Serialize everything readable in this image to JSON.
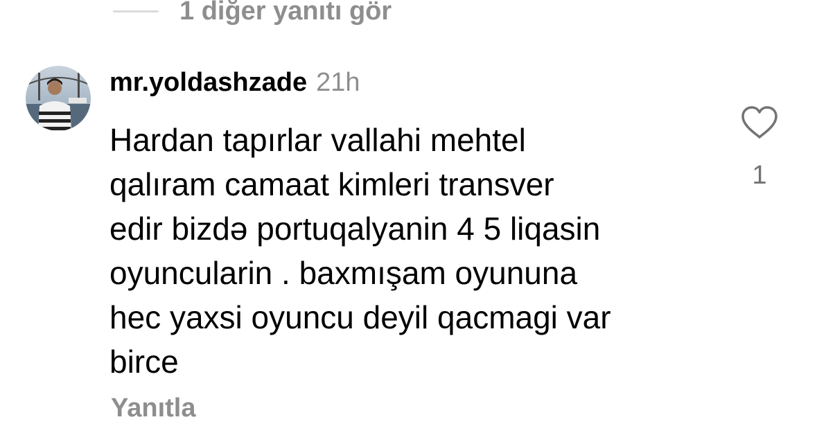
{
  "view_replies": {
    "label": "1 diğer yanıtı gör"
  },
  "comment": {
    "avatar_icon": "user-avatar-photo",
    "username": "mr.yoldashzade",
    "time": "21h",
    "text_lines": [
      "Hardan tapırlar vallahi  mehtel",
      "qalıram camaat kimleri transver",
      "edir bizdə portuqalyanin 4 5 liqasin",
      "oyuncularin . baxmışam oyununa",
      "hec yaxsi oyuncu deyil qacmagi var",
      "birce"
    ],
    "reply_label": "Yanıtla",
    "like_icon": "heart-outline-icon",
    "like_count": "1"
  },
  "colors": {
    "text_primary": "#000000",
    "text_secondary": "#8e8e8e",
    "divider": "#dbdbdb",
    "like_count": "#737373"
  }
}
